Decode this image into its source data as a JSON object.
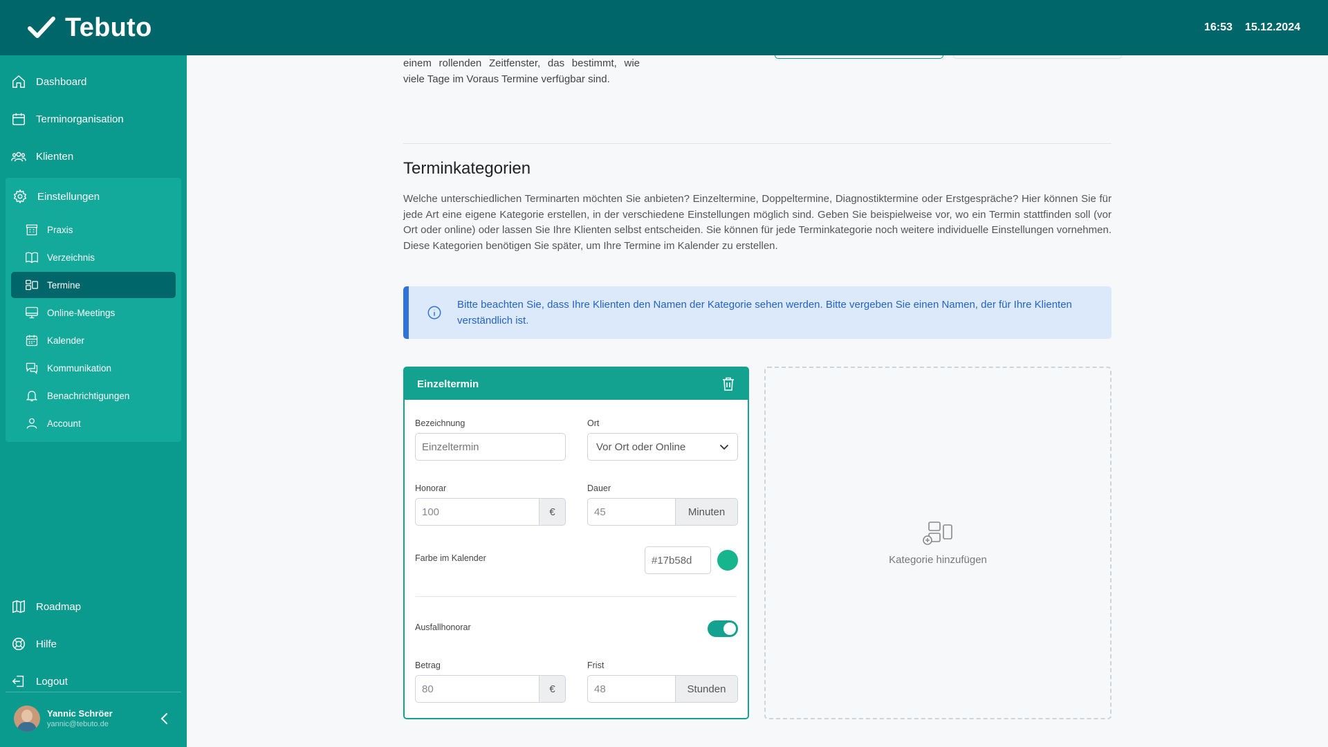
{
  "header": {
    "brand": "Tebuto",
    "time": "16:53",
    "date": "15.12.2024",
    "color": "#01666a"
  },
  "sidebar": {
    "main_items": [
      {
        "label": "Dashboard",
        "icon": "home-icon"
      },
      {
        "label": "Terminorganisation",
        "icon": "calendar-icon"
      },
      {
        "label": "Klienten",
        "icon": "users-icon"
      }
    ],
    "settings": {
      "label": "Einstellungen",
      "icon": "gear-icon",
      "items": [
        {
          "label": "Praxis",
          "icon": "building-icon"
        },
        {
          "label": "Verzeichnis",
          "icon": "book-icon"
        },
        {
          "label": "Termine",
          "icon": "appointments-icon",
          "active": true
        },
        {
          "label": "Online-Meetings",
          "icon": "monitor-icon"
        },
        {
          "label": "Kalender",
          "icon": "calendar-grid-icon"
        },
        {
          "label": "Kommunikation",
          "icon": "chat-icon"
        },
        {
          "label": "Benachrichtigungen",
          "icon": "bell-icon"
        },
        {
          "label": "Account",
          "icon": "user-icon"
        }
      ]
    },
    "bottom_items": [
      {
        "label": "Roadmap",
        "icon": "map-icon"
      },
      {
        "label": "Hilfe",
        "icon": "lifebuoy-icon"
      },
      {
        "label": "Logout",
        "icon": "logout-icon"
      }
    ],
    "profile": {
      "name": "Yannic Schröer",
      "email": "yannic@tebuto.de"
    }
  },
  "main": {
    "top_text": "einem rollenden Zeitfenster, das bestimmt, wie viele Tage im Voraus Termine verfügbar sind.",
    "section_title": "Terminkategorien",
    "section_description": "Welche unterschiedlichen Terminarten möchten Sie anbieten? Einzeltermine, Doppeltermine, Diagnostiktermine oder Erstgespräche? Hier können Sie für jede Art eine eigene Kategorie erstellen, in der verschiedene Einstellungen möglich sind. Geben Sie beispielweise vor, wo ein Termin stattfinden soll (vor Ort oder online) oder lassen Sie Ihre Klienten selbst entscheiden. Sie können für jede Terminkate­gorie noch weitere individuelle Einstellungen vornehmen. Diese Kategorien benötigen Sie später, um Ihre Termine im Kalender zu erstellen.",
    "info_text": "Bitte beachten Sie, dass Ihre Klienten den Namen der Kategorie sehen werden. Bitte vergeben Sie einen Namen, der für Ihre Klienten verständlich ist.",
    "category_card": {
      "title": "Einzeltermin",
      "bezeichnung_label": "Bezeichnung",
      "bezeichnung_value": "Einzeltermin",
      "ort_label": "Ort",
      "ort_value": "Vor Ort oder Online",
      "honorar_label": "Honorar",
      "honorar_value": "100",
      "honorar_unit": "€",
      "dauer_label": "Dauer",
      "dauer_value": "45",
      "dauer_unit": "Minuten",
      "farbe_label": "Farbe im Kalender",
      "farbe_value": "#17b58d",
      "ausfall_label": "Ausfallhonorar",
      "ausfall_enabled": true,
      "betrag_label": "Betrag",
      "betrag_value": "80",
      "betrag_unit": "€",
      "frist_label": "Frist",
      "frist_value": "48",
      "frist_unit": "Stunden"
    },
    "add_category_label": "Kategorie hinzufügen"
  }
}
